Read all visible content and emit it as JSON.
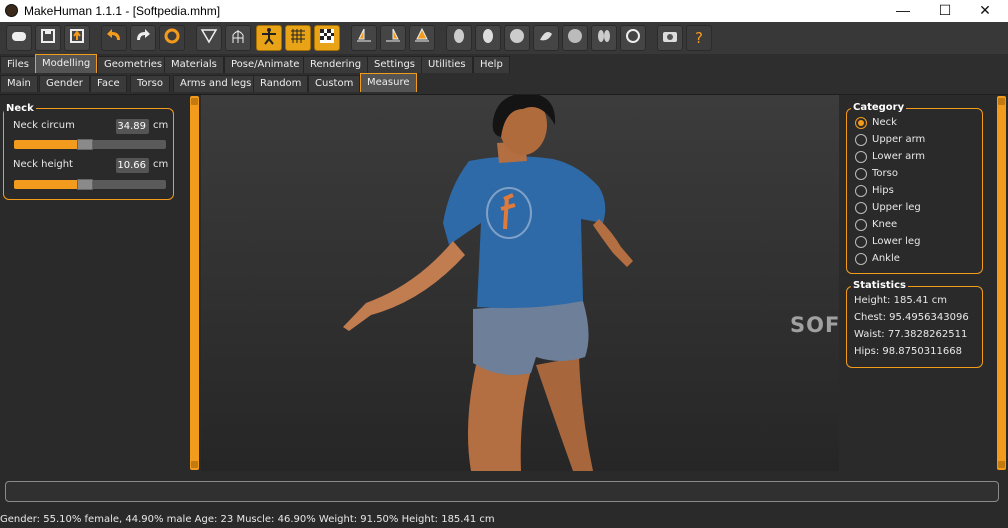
{
  "window": {
    "title": "MakeHuman 1.1.1 - [Softpedia.mhm]",
    "minimize": "—",
    "maximize": "☐",
    "close": "✕"
  },
  "toolbar": {
    "icons": [
      "new-file",
      "save",
      "export",
      "undo",
      "redo",
      "reset",
      "smooth",
      "wireframe-body",
      "pose-active",
      "grid-active",
      "checker-active",
      "front-view",
      "back-view",
      "side-view",
      "head-view",
      "skin",
      "hair",
      "eyebrows",
      "teeth",
      "eyes",
      "ears",
      "rotate",
      "screenshot",
      "help"
    ],
    "help_glyph": "?"
  },
  "main_tabs": [
    "Files",
    "Modelling",
    "Geometries",
    "Materials",
    "Pose/Animate",
    "Rendering",
    "Settings",
    "Utilities",
    "Help"
  ],
  "main_tab_selected": "Modelling",
  "sub_tabs": [
    "Main",
    "Gender",
    "Face",
    "Torso",
    "Arms and legs",
    "Random",
    "Custom",
    "Measure"
  ],
  "sub_tab_selected": "Measure",
  "left": {
    "group_title": "Neck",
    "sliders": [
      {
        "label": "Neck circum",
        "value": "34.89",
        "unit": "cm",
        "fill": 0.47
      },
      {
        "label": "Neck height",
        "value": "10.66",
        "unit": "cm",
        "fill": 0.47
      }
    ]
  },
  "right": {
    "category_title": "Category",
    "categories": [
      "Neck",
      "Upper arm",
      "Lower arm",
      "Torso",
      "Hips",
      "Upper leg",
      "Knee",
      "Lower leg",
      "Ankle"
    ],
    "selected_category": "Neck",
    "statistics_title": "Statistics",
    "stats": [
      "Height: 185.41 cm",
      "Chest: 95.4956343096",
      "Waist: 77.3828262511",
      "Hips: 98.8750311668"
    ]
  },
  "watermark": "SOFTPEDIA",
  "status": "Gender: 55.10% female, 44.90% male Age: 23 Muscle: 46.90% Weight: 91.50% Height: 185.41 cm",
  "colors": {
    "accent": "#f39b1d",
    "background": "#2a2a2a",
    "shirt": "#2e6aa8",
    "skin": "#c17c4f"
  }
}
